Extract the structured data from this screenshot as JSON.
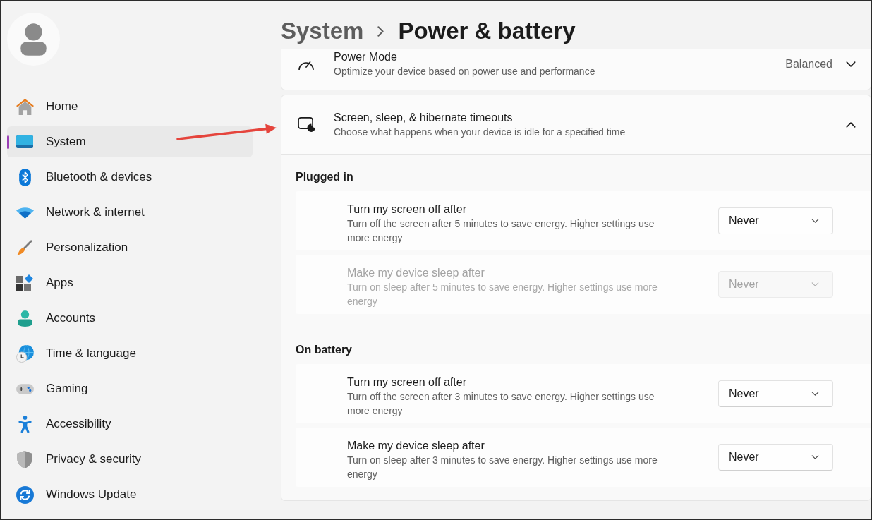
{
  "sidebar": {
    "items": [
      {
        "label": "Home",
        "selected": false
      },
      {
        "label": "System",
        "selected": true
      },
      {
        "label": "Bluetooth & devices",
        "selected": false
      },
      {
        "label": "Network & internet",
        "selected": false
      },
      {
        "label": "Personalization",
        "selected": false
      },
      {
        "label": "Apps",
        "selected": false
      },
      {
        "label": "Accounts",
        "selected": false
      },
      {
        "label": "Time & language",
        "selected": false
      },
      {
        "label": "Gaming",
        "selected": false
      },
      {
        "label": "Accessibility",
        "selected": false
      },
      {
        "label": "Privacy & security",
        "selected": false
      },
      {
        "label": "Windows Update",
        "selected": false
      }
    ]
  },
  "breadcrumb": [
    {
      "label": "System",
      "current": false
    },
    {
      "label": "Power & battery",
      "current": true
    }
  ],
  "settings": [
    {
      "kind": "dropdown",
      "title": "Power Mode",
      "description": "Optimize your device based on power use and performance",
      "value": "Balanced"
    },
    {
      "kind": "expander",
      "title": "Screen, sleep, & hibernate timeouts",
      "description": "Choose what happens when your device is idle for a specified time",
      "expanded": true,
      "groups": [
        {
          "heading": "Plugged in",
          "rows": [
            {
              "title": "Turn my screen off after",
              "description": "Turn off the screen after 5 minutes to save energy. Higher settings use more energy",
              "value": "Never",
              "disabled": false
            },
            {
              "title": "Make my device sleep after",
              "description": "Turn on sleep after 5 minutes to save energy. Higher settings use more energy",
              "value": "Never",
              "disabled": true
            }
          ]
        },
        {
          "heading": "On battery",
          "rows": [
            {
              "title": "Turn my screen off after",
              "description": "Turn off the screen after 3 minutes to save energy. Higher settings use more energy",
              "value": "Never",
              "disabled": false
            },
            {
              "title": "Make my device sleep after",
              "description": "Turn on sleep after 3 minutes to save energy. Higher settings use more energy",
              "value": "Never",
              "disabled": false
            }
          ]
        }
      ]
    }
  ]
}
